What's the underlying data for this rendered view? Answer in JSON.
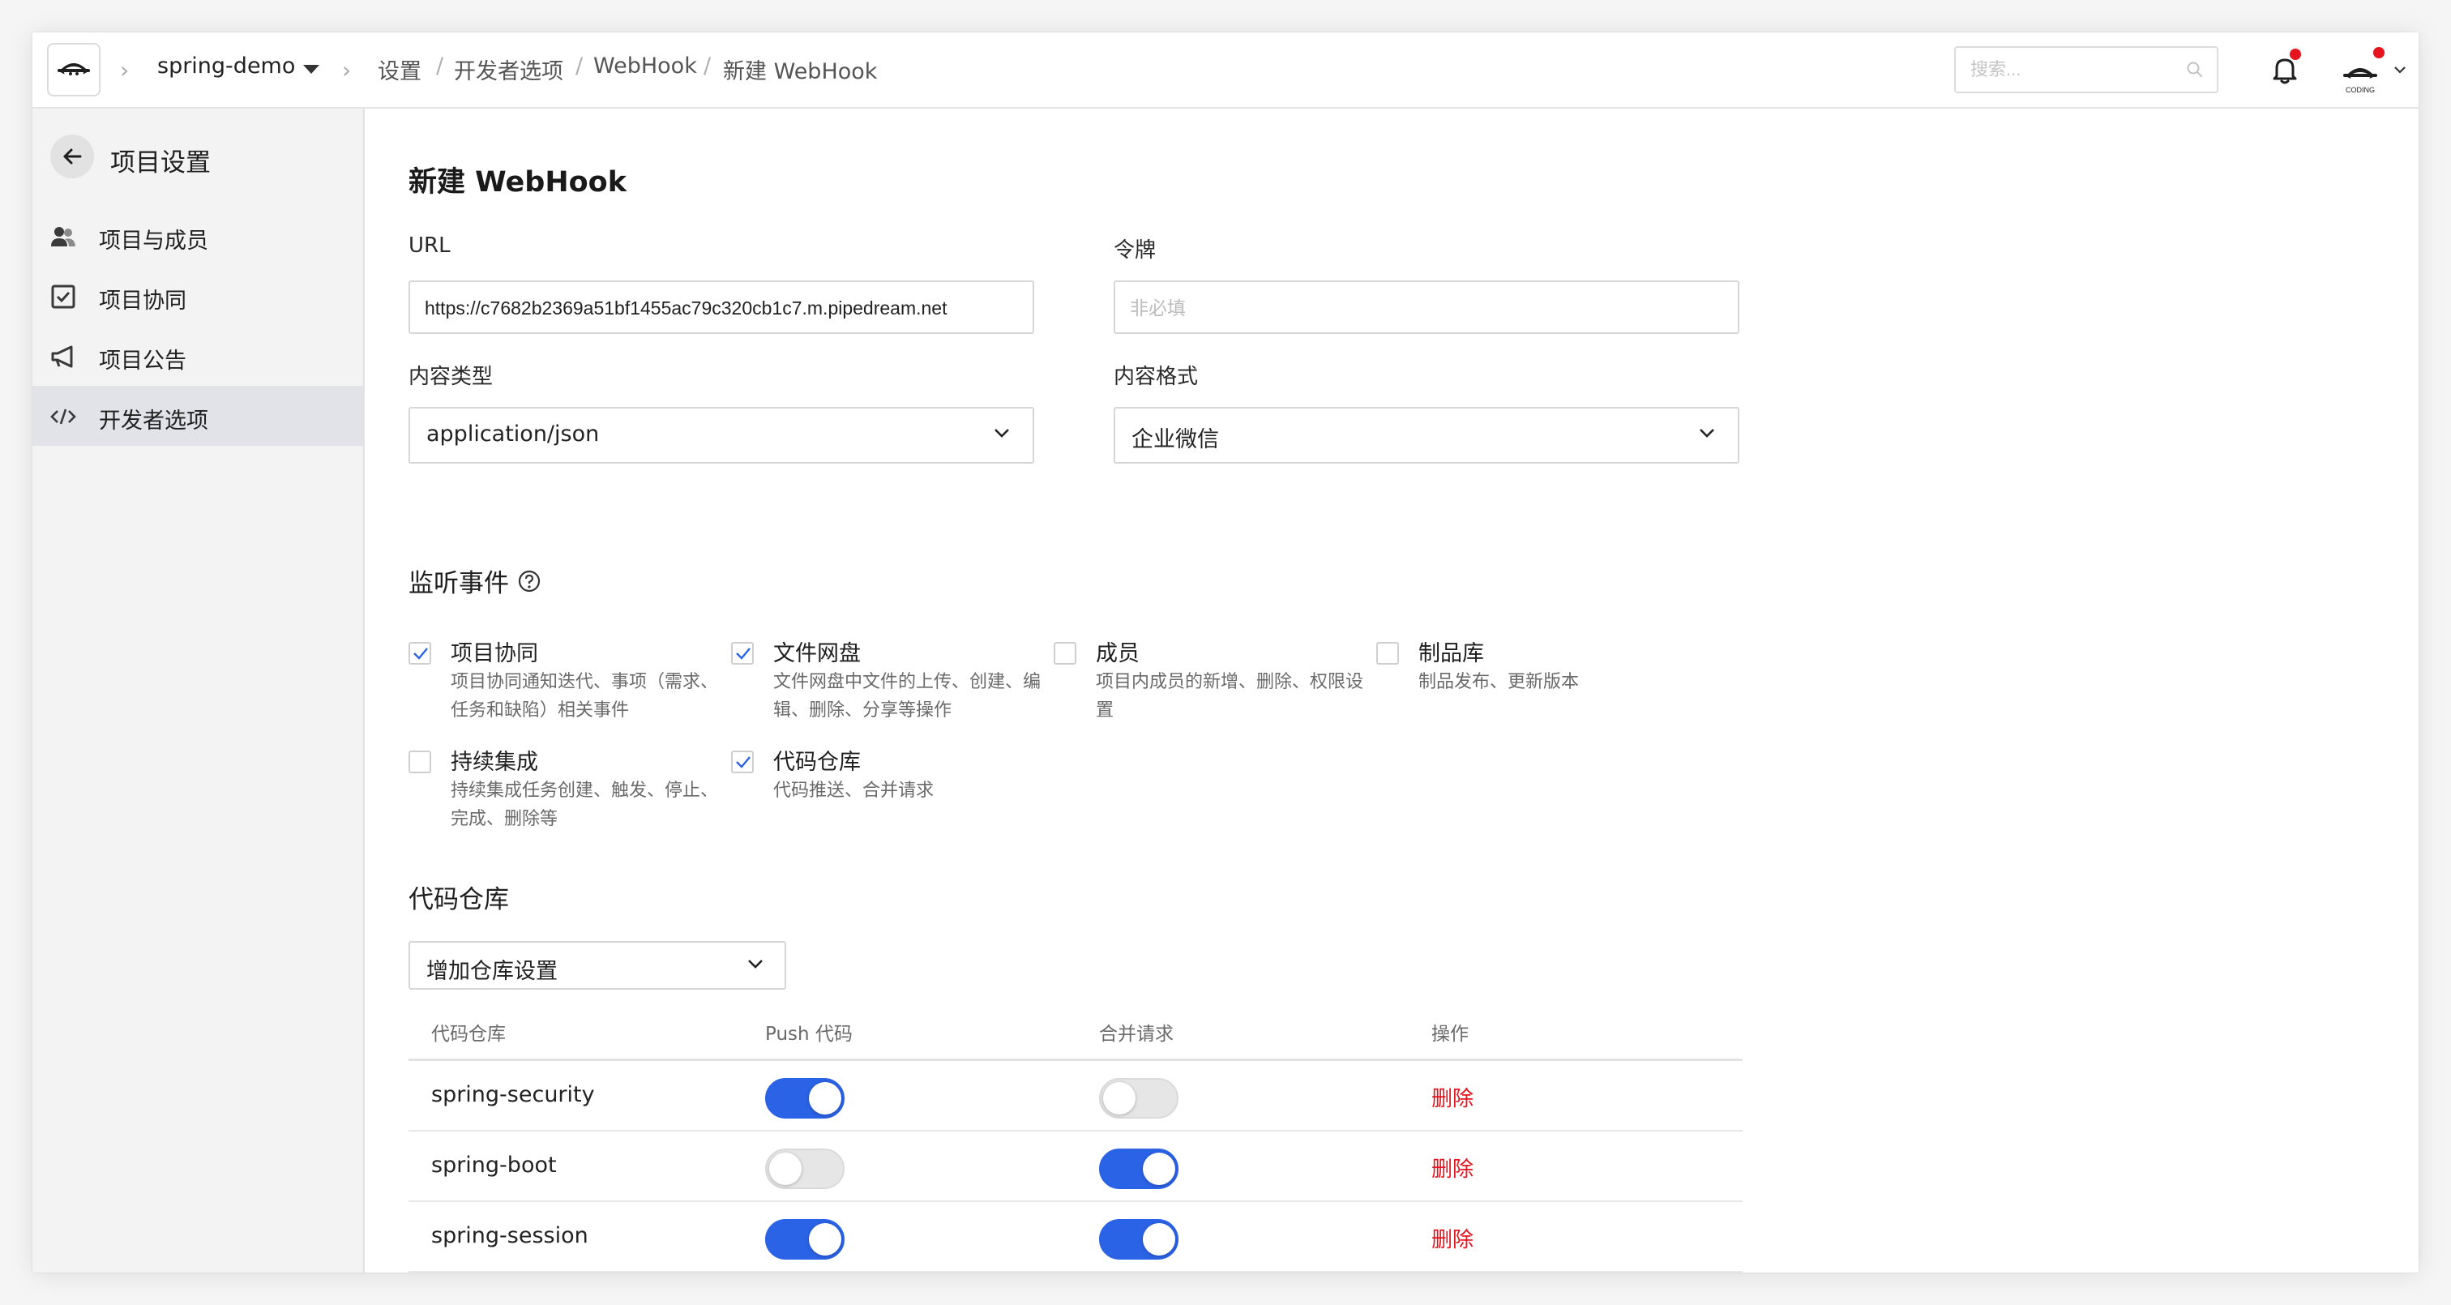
{
  "header": {
    "project_name": "spring-demo",
    "breadcrumb": [
      "设置",
      "开发者选项",
      "WebHook",
      "新建 WebHook"
    ],
    "search_placeholder": "搜索..."
  },
  "sidebar": {
    "title": "项目设置",
    "items": [
      {
        "label": "项目与成员",
        "icon": "users-icon"
      },
      {
        "label": "项目协同",
        "icon": "checkbox-icon"
      },
      {
        "label": "项目公告",
        "icon": "megaphone-icon"
      },
      {
        "label": "开发者选项",
        "icon": "code-icon",
        "active": true
      }
    ]
  },
  "form": {
    "title": "新建 WebHook",
    "url_label": "URL",
    "url_value": "https://c7682b2369a51bf1455ac79c320cb1c7.m.pipedream.net",
    "token_label": "令牌",
    "token_placeholder": "非必填",
    "content_type_label": "内容类型",
    "content_type_value": "application/json",
    "content_format_label": "内容格式",
    "content_format_value": "企业微信"
  },
  "events": {
    "title": "监听事件",
    "items": [
      {
        "title": "项目协同",
        "desc": "项目协同通知迭代、事项（需求、任务和缺陷）相关事件",
        "checked": true
      },
      {
        "title": "文件网盘",
        "desc": "文件网盘中文件的上传、创建、编辑、删除、分享等操作",
        "checked": true
      },
      {
        "title": "成员",
        "desc": "项目内成员的新增、删除、权限设置",
        "checked": false
      },
      {
        "title": "制品库",
        "desc": "制品发布、更新版本",
        "checked": false
      },
      {
        "title": "持续集成",
        "desc": "持续集成任务创建、触发、停止、完成、删除等",
        "checked": false
      },
      {
        "title": "代码仓库",
        "desc": "代码推送、合并请求",
        "checked": true
      }
    ]
  },
  "repos": {
    "title": "代码仓库",
    "add_select": "增加仓库设置",
    "columns": [
      "代码仓库",
      "Push 代码",
      "合并请求",
      "操作"
    ],
    "rows": [
      {
        "name": "spring-security",
        "push": true,
        "merge": false,
        "action": "删除"
      },
      {
        "name": "spring-boot",
        "push": false,
        "merge": true,
        "action": "删除"
      },
      {
        "name": "spring-session",
        "push": true,
        "merge": true,
        "action": "删除"
      }
    ]
  },
  "colors": {
    "accent": "#2b63e6",
    "danger": "#e5141e",
    "notification": "#e5141e"
  }
}
